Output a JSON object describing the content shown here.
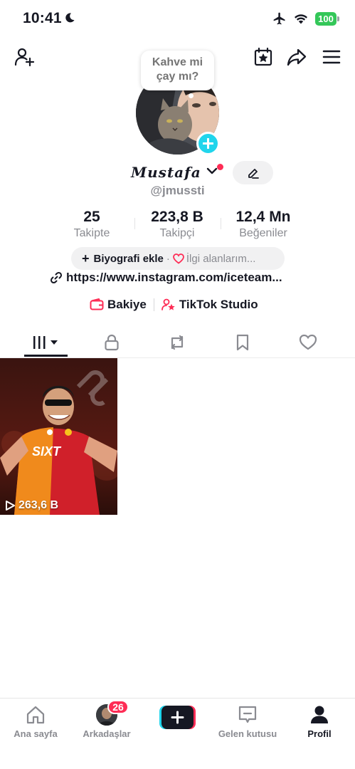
{
  "status_bar": {
    "time": "10:41",
    "battery": "100",
    "icons": [
      "moon-icon",
      "airplane-icon",
      "wifi-icon",
      "battery-icon"
    ]
  },
  "top_nav": {
    "icons": [
      "add-friend-icon",
      "calendar-star-icon",
      "share-icon",
      "menu-icon"
    ]
  },
  "profile": {
    "bubble_text": "Kahve mi\nçay mı?",
    "display_name": "Mustafa",
    "username": "@jmussti"
  },
  "stats": {
    "following": {
      "value": "25",
      "label": "Takipte"
    },
    "followers": {
      "value": "223,8 B",
      "label": "Takipçi"
    },
    "likes": {
      "value": "12,4 Mn",
      "label": "Beğeniler"
    }
  },
  "bio": {
    "add_bio": "Biyografi ekle",
    "separator": "·",
    "interests": "İlgi alanlarım..."
  },
  "link": "https://www.instagram.com/iceteam...",
  "shortcuts": {
    "balance": "Bakiye",
    "studio": "TikTok Studio"
  },
  "tabs": [
    "videos-grid-icon",
    "lock-icon",
    "repost-icon",
    "bookmark-icon",
    "heart-icon"
  ],
  "videos": [
    {
      "views": "263,6 B"
    }
  ],
  "bottom_nav": {
    "home": "Ana sayfa",
    "friends": "Arkadaşlar",
    "friends_badge": "26",
    "inbox": "Gelen kutusu",
    "profile": "Profil"
  },
  "colors": {
    "accent_red": "#fe2c55",
    "accent_cyan": "#20d5ec",
    "battery_green": "#34c759"
  }
}
